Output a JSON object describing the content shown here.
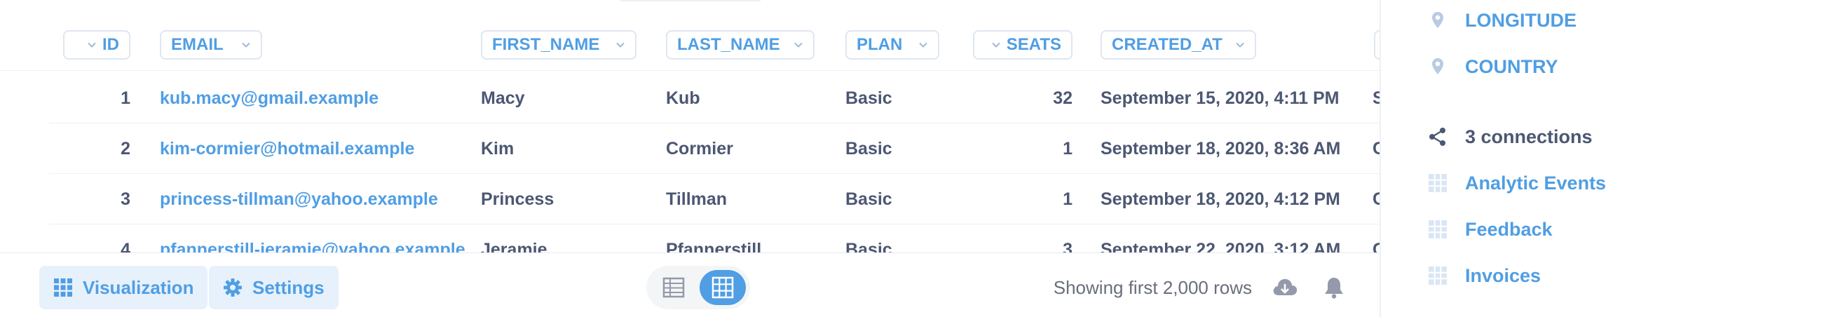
{
  "table": {
    "columns": [
      {
        "key": "id",
        "label": "ID"
      },
      {
        "key": "email",
        "label": "EMAIL"
      },
      {
        "key": "first_name",
        "label": "FIRST_NAME"
      },
      {
        "key": "last_name",
        "label": "LAST_NAME"
      },
      {
        "key": "plan",
        "label": "PLAN"
      },
      {
        "key": "seats",
        "label": "SEATS"
      },
      {
        "key": "created_at",
        "label": "CREATED_AT"
      }
    ],
    "rows": [
      {
        "id": "1",
        "email": "kub.macy@gmail.example",
        "first_name": "Macy",
        "last_name": "Kub",
        "plan": "Basic",
        "seats": "32",
        "created_at": "September 15, 2020, 4:11 PM",
        "overflow": "S"
      },
      {
        "id": "2",
        "email": "kim-cormier@hotmail.example",
        "first_name": "Kim",
        "last_name": "Cormier",
        "plan": "Basic",
        "seats": "1",
        "created_at": "September 18, 2020, 8:36 AM",
        "overflow": "C"
      },
      {
        "id": "3",
        "email": "princess-tillman@yahoo.example",
        "first_name": "Princess",
        "last_name": "Tillman",
        "plan": "Basic",
        "seats": "1",
        "created_at": "September 18, 2020, 4:12 PM",
        "overflow": "C"
      },
      {
        "id": "4",
        "email": "pfannerstill-jeramie@yahoo.example",
        "first_name": "Jeramie",
        "last_name": "Pfannerstill",
        "plan": "Basic",
        "seats": "3",
        "created_at": "September 22, 2020, 3:12 AM",
        "overflow": "C"
      }
    ]
  },
  "footer": {
    "visualization_label": "Visualization",
    "settings_label": "Settings",
    "row_count": "Showing first 2,000 rows",
    "icons": {
      "download": "download-icon",
      "alert": "bell-icon",
      "table_view": "table-icon",
      "grid_view": "grid-icon"
    }
  },
  "panel": {
    "fields": [
      {
        "label": "LONGITUDE",
        "icon": "location-pin-icon"
      },
      {
        "label": "COUNTRY",
        "icon": "location-pin-icon"
      }
    ],
    "connections_label": "3 connections",
    "connections": [
      {
        "label": "Analytic Events",
        "icon": "table-grid-icon"
      },
      {
        "label": "Feedback",
        "icon": "table-grid-icon"
      },
      {
        "label": "Invoices",
        "icon": "table-grid-icon"
      }
    ]
  },
  "colors": {
    "accent": "#509ee3",
    "text": "#4c5773",
    "muted": "#696e7b",
    "button_bg": "#e6f1fc",
    "icon_muted": "#949aab"
  }
}
